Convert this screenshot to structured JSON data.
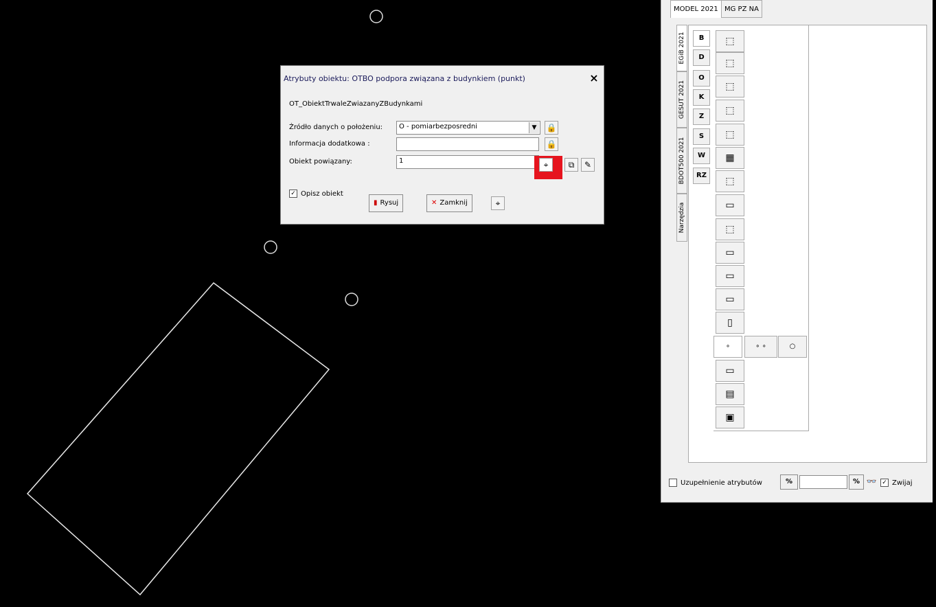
{
  "dialog": {
    "title": "Atrybuty obiektu: OTBO podpora związana z budynkiem (punkt)",
    "close_icon": "×",
    "class_name": "OT_ObiektTrwaleZwiazanyZBudynkami",
    "fields": {
      "source_label": "Źródło danych o położeniu:",
      "source_value": "O - pomiarbezposredni",
      "info_label": "Informacja dodatkowa :",
      "info_value": "",
      "related_label": "Obiekt powiązany:",
      "related_value": "1"
    },
    "describe_checkbox": {
      "label": "Opisz obiekt",
      "checked": true
    },
    "draw_button": "Rysuj",
    "close_button": "Zamknij"
  },
  "panel": {
    "top_tabs": [
      "MODEL 2021",
      "MG PZ NA"
    ],
    "side_tabs": [
      "EGiB 2021",
      "GESUT 2021",
      "BDOT500 2021",
      "Narzędzia"
    ],
    "letter_tabs": [
      "B",
      "D",
      "O",
      "K",
      "Z",
      "S",
      "W",
      "RZ"
    ],
    "bottom": {
      "fill_attributes_label": "Uzupełnienie atrybutów",
      "fill_attributes_checked": false,
      "percent_left": "%",
      "percent_right": "%",
      "search_value": "",
      "collapse_label": "Zwijaj",
      "collapse_checked": true
    }
  }
}
